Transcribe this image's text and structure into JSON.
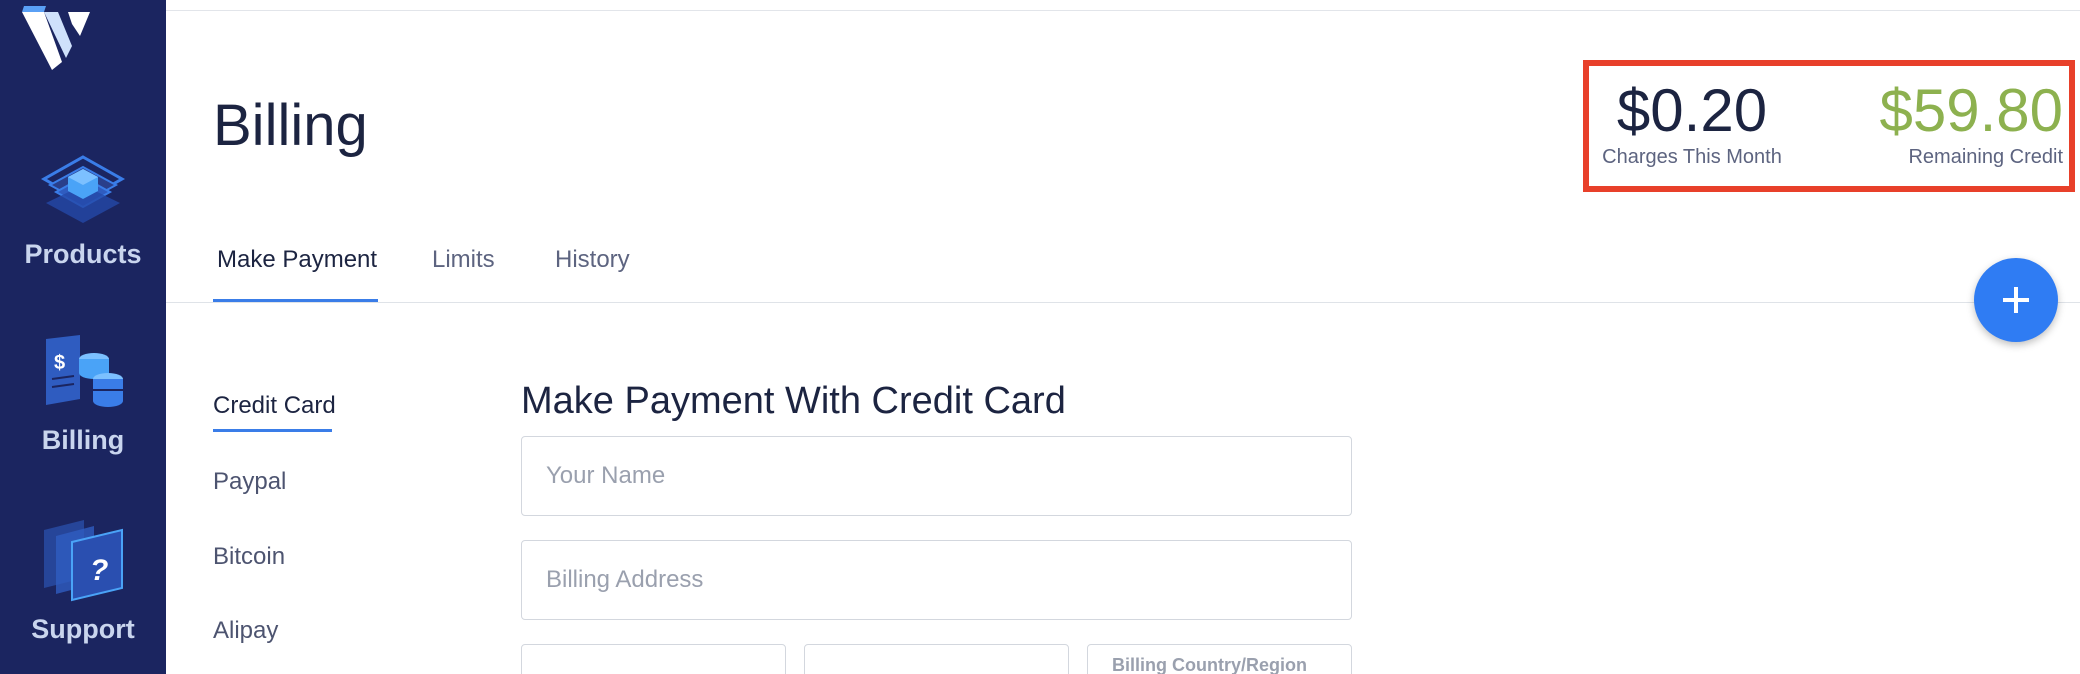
{
  "sidebar": {
    "items": [
      {
        "label": "Products",
        "icon": "layers-icon"
      },
      {
        "label": "Billing",
        "icon": "billing-icon"
      },
      {
        "label": "Support",
        "icon": "support-icon"
      }
    ]
  },
  "page": {
    "title": "Billing"
  },
  "summary": {
    "charges_value": "$0.20",
    "charges_label": "Charges This Month",
    "credit_value": "$59.80",
    "credit_label": "Remaining Credit"
  },
  "tabs": [
    {
      "label": "Make Payment",
      "active": true
    },
    {
      "label": "Limits",
      "active": false
    },
    {
      "label": "History",
      "active": false
    }
  ],
  "fab": {
    "icon": "plus-icon"
  },
  "payment_methods": [
    {
      "label": "Credit Card",
      "active": true
    },
    {
      "label": "Paypal",
      "active": false
    },
    {
      "label": "Bitcoin",
      "active": false
    },
    {
      "label": "Alipay",
      "active": false
    }
  ],
  "form": {
    "title": "Make Payment With Credit Card",
    "name_placeholder": "Your Name",
    "address_placeholder": "Billing Address",
    "country_label": "Billing Country/Region"
  },
  "colors": {
    "sidebar_bg": "#1b2560",
    "accent": "#2f7cf3",
    "credit_green": "#8db14f",
    "highlight_border": "#e8402a"
  }
}
